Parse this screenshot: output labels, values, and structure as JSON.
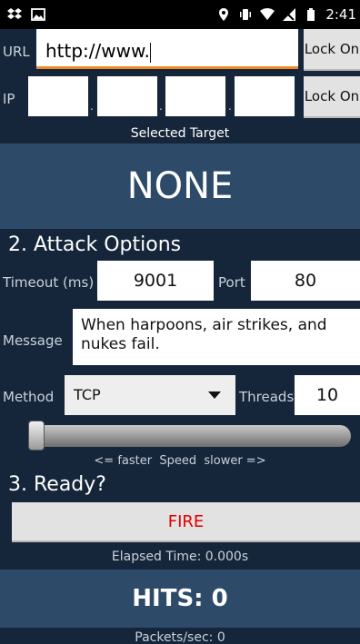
{
  "status_bar": {
    "time": "2:41",
    "left_icons": [
      "dropbox-icon",
      "image-icon"
    ],
    "right_icons": [
      "location-pin-icon",
      "vibrate-icon",
      "wifi-icon",
      "no-signal-icon",
      "battery-icon"
    ]
  },
  "target": {
    "url_label": "URL",
    "url_value": "http://www.",
    "url_lock_label": "Lock On",
    "ip_label": "IP",
    "ip_octets": [
      "",
      "",
      "",
      ""
    ],
    "ip_separator": ".",
    "ip_lock_label": "Lock On",
    "selected_caption": "Selected Target",
    "selected_value": "NONE"
  },
  "attack_options": {
    "title": "2. Attack Options",
    "timeout_label": "Timeout (ms)",
    "timeout_value": "9001",
    "port_label": "Port",
    "port_value": "80",
    "message_label": "Message",
    "message_value": "When harpoons, air strikes, and nukes fail.",
    "method_label": "Method",
    "method_value": "TCP",
    "threads_label": "Threads",
    "threads_value": "10",
    "speed_caption": "<= faster  Speed  slower =>",
    "speed_level": 0
  },
  "ready": {
    "title": "3. Ready?",
    "fire_label": "FIRE",
    "elapsed": "Elapsed Time: 0.000s",
    "hits": "HITS: 0",
    "packets": "Packets/sec: 0"
  },
  "colors": {
    "background": "#16263a",
    "panel": "#2d4a68",
    "fire_text": "#e00000",
    "url_focus": "#f08a24"
  }
}
